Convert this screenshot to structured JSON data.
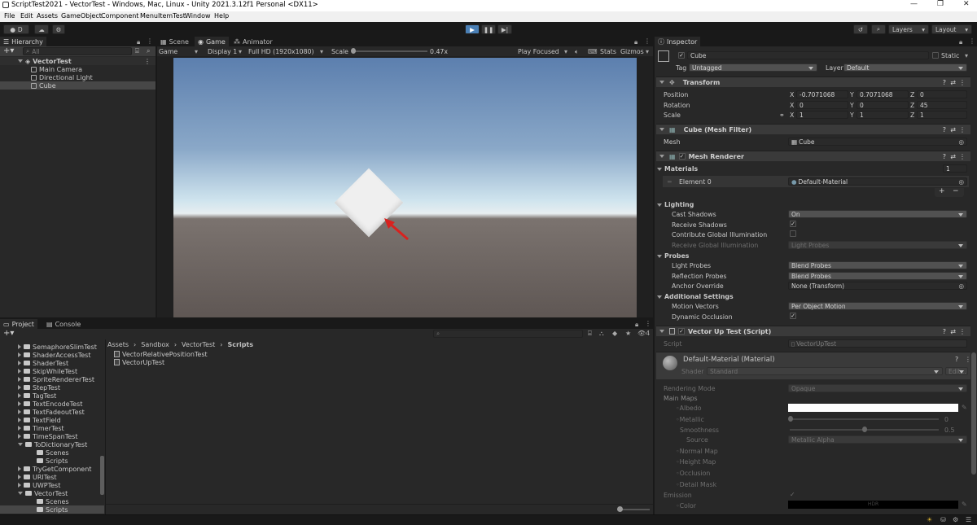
{
  "window": {
    "title": "ScriptTest2021 - VectorTest - Windows, Mac, Linux - Unity 2021.3.12f1 Personal <DX11>",
    "min": "—",
    "max": "❐",
    "close": "✕"
  },
  "menu": [
    "File",
    "Edit",
    "Assets",
    "GameObject",
    "Component",
    "MenuItemTest",
    "Window",
    "Help"
  ],
  "toolbar": {
    "account": "D",
    "layers": "Layers",
    "layout": "Layout"
  },
  "hierarchy": {
    "tab": "Hierarchy",
    "search_placeholder": "All",
    "scene": "VectorTest",
    "items": [
      "Main Camera",
      "Directional Light",
      "Cube"
    ]
  },
  "gameview": {
    "tabs": [
      "Scene",
      "Game",
      "Animator"
    ],
    "mode": "Game",
    "display": "Display 1",
    "resolution": "Full HD (1920x1080)",
    "scale_label": "Scale",
    "scale_value": "0.47x",
    "play_focused": "Play Focused",
    "stats": "Stats",
    "gizmos": "Gizmos"
  },
  "project": {
    "tabs": [
      "Project",
      "Console"
    ],
    "breadcrumb": [
      "Assets",
      "Sandbox",
      "VectorTest",
      "Scripts"
    ],
    "tree": [
      {
        "label": "SemaphoreSlimTest",
        "indent": 0,
        "arrow": "right"
      },
      {
        "label": "ShaderAccessTest",
        "indent": 0,
        "arrow": "right"
      },
      {
        "label": "ShaderTest",
        "indent": 0,
        "arrow": "right"
      },
      {
        "label": "SkipWhileTest",
        "indent": 0,
        "arrow": "right"
      },
      {
        "label": "SpriteRendererTest",
        "indent": 0,
        "arrow": "right"
      },
      {
        "label": "StepTest",
        "indent": 0,
        "arrow": "right"
      },
      {
        "label": "TagTest",
        "indent": 0,
        "arrow": "right"
      },
      {
        "label": "TextEncodeTest",
        "indent": 0,
        "arrow": "right"
      },
      {
        "label": "TextFadeoutTest",
        "indent": 0,
        "arrow": "right"
      },
      {
        "label": "TextField",
        "indent": 0,
        "arrow": "right"
      },
      {
        "label": "TimerTest",
        "indent": 0,
        "arrow": "right"
      },
      {
        "label": "TimeSpanTest",
        "indent": 0,
        "arrow": "right"
      },
      {
        "label": "ToDictionaryTest",
        "indent": 0,
        "arrow": "down"
      },
      {
        "label": "Scenes",
        "indent": 1,
        "arrow": ""
      },
      {
        "label": "Scripts",
        "indent": 1,
        "arrow": ""
      },
      {
        "label": "TryGetComponent",
        "indent": 0,
        "arrow": "right"
      },
      {
        "label": "URITest",
        "indent": 0,
        "arrow": "right"
      },
      {
        "label": "UWPTest",
        "indent": 0,
        "arrow": "right"
      },
      {
        "label": "VectorTest",
        "indent": 0,
        "arrow": "down"
      },
      {
        "label": "Scenes",
        "indent": 1,
        "arrow": ""
      },
      {
        "label": "Scripts",
        "indent": 1,
        "arrow": "",
        "selected": true
      }
    ],
    "files": [
      "VectorRelativePositionTest",
      "VectorUpTest"
    ],
    "hidden_count": "4"
  },
  "inspector": {
    "tab": "Inspector",
    "object_name": "Cube",
    "static": "Static",
    "tag_label": "Tag",
    "tag_value": "Untagged",
    "layer_label": "Layer",
    "layer_value": "Default",
    "transform": {
      "title": "Transform",
      "position": {
        "label": "Position",
        "x": "-0.7071068",
        "y": "0.7071068",
        "z": "0"
      },
      "rotation": {
        "label": "Rotation",
        "x": "0",
        "y": "0",
        "z": "45"
      },
      "scale": {
        "label": "Scale",
        "x": "1",
        "y": "1",
        "z": "1"
      }
    },
    "mesh_filter": {
      "title": "Cube (Mesh Filter)",
      "mesh_label": "Mesh",
      "mesh_value": "Cube"
    },
    "mesh_renderer": {
      "title": "Mesh Renderer",
      "materials_label": "Materials",
      "materials_count": "1",
      "element0_label": "Element 0",
      "element0_value": "Default-Material",
      "lighting": "Lighting",
      "cast_shadows_label": "Cast Shadows",
      "cast_shadows_value": "On",
      "receive_shadows_label": "Receive Shadows",
      "contribute_gi_label": "Contribute Global Illumination",
      "receive_gi_label": "Receive Global Illumination",
      "receive_gi_value": "Light Probes",
      "probes": "Probes",
      "light_probes_label": "Light Probes",
      "light_probes_value": "Blend Probes",
      "reflection_probes_label": "Reflection Probes",
      "reflection_probes_value": "Blend Probes",
      "anchor_override_label": "Anchor Override",
      "anchor_override_value": "None (Transform)",
      "additional": "Additional Settings",
      "motion_vectors_label": "Motion Vectors",
      "motion_vectors_value": "Per Object Motion",
      "dynamic_occlusion_label": "Dynamic Occlusion"
    },
    "script_comp": {
      "title": "Vector Up Test (Script)",
      "script_label": "Script",
      "script_value": "VectorUpTest"
    },
    "material": {
      "title": "Default-Material (Material)",
      "shader_label": "Shader",
      "shader_value": "Standard",
      "edit": "Edit...",
      "rendering_mode_label": "Rendering Mode",
      "rendering_mode_value": "Opaque",
      "main_maps": "Main Maps",
      "albedo": "Albedo",
      "metallic": "Metallic",
      "metallic_value": "0",
      "smoothness": "Smoothness",
      "smoothness_value": "0.5",
      "source": "Source",
      "source_value": "Metallic Alpha",
      "normal_map": "Normal Map",
      "height_map": "Height Map",
      "occlusion": "Occlusion",
      "detail_mask": "Detail Mask",
      "emission": "Emission",
      "color": "Color",
      "hdr": "HDR"
    }
  }
}
